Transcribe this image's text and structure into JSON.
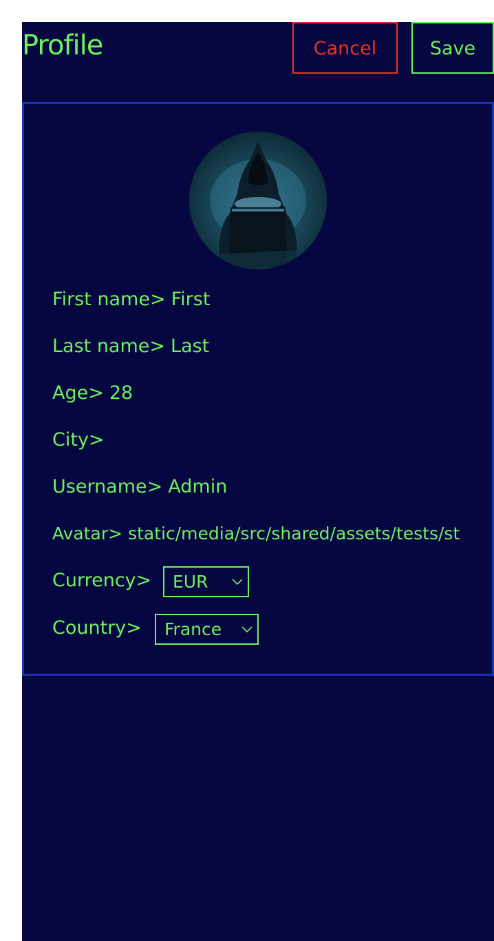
{
  "header": {
    "title": "Profile",
    "cancel_label": "Cancel",
    "save_label": "Save"
  },
  "profile": {
    "avatar_icon": "hooded-hacker-avatar",
    "fields": {
      "first_name": {
        "label": "First name>",
        "value": "First"
      },
      "last_name": {
        "label": "Last name>",
        "value": "Last"
      },
      "age": {
        "label": "Age>",
        "value": "28"
      },
      "city": {
        "label": "City>",
        "value": ""
      },
      "username": {
        "label": "Username>",
        "value": "Admin"
      },
      "avatar": {
        "label": "Avatar>",
        "value": "static/media/src/shared/assets/tests/st"
      }
    },
    "currency": {
      "label": "Currency>",
      "selected": "EUR"
    },
    "country": {
      "label": "Country>",
      "selected": "France"
    }
  },
  "colors": {
    "background": "#060640",
    "text": "#6cf25d",
    "cancel": "#e63426",
    "card_border": "#1532b8"
  }
}
